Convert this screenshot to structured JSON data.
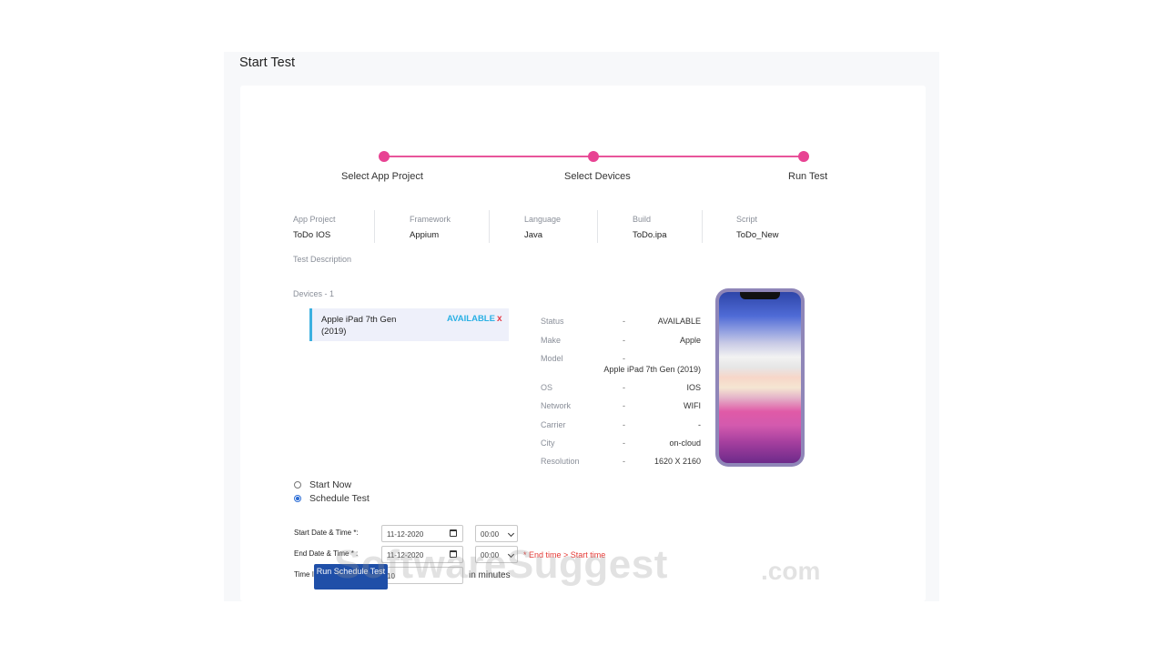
{
  "page": {
    "title": "Start Test"
  },
  "stepper": {
    "steps": [
      {
        "label": "Select App Project"
      },
      {
        "label": "Select Devices"
      },
      {
        "label": "Run Test"
      }
    ],
    "accent": "#e84393"
  },
  "meta": {
    "app_project": {
      "label": "App Project",
      "value": "ToDo IOS"
    },
    "framework": {
      "label": "Framework",
      "value": "Appium"
    },
    "language": {
      "label": "Language",
      "value": "Java"
    },
    "build": {
      "label": "Build",
      "value": "ToDo.ipa"
    },
    "script": {
      "label": "Script",
      "value": "ToDo_New"
    },
    "test_description": {
      "label": "Test Description"
    }
  },
  "devices": {
    "heading": "Devices - 1",
    "selected": {
      "name": "Apple iPad 7th Gen (2019)",
      "status": "AVAILABLE",
      "remove": "x"
    },
    "dash": "-",
    "specs": {
      "status": {
        "label": "Status",
        "value": "AVAILABLE"
      },
      "make": {
        "label": "Make",
        "value": "Apple"
      },
      "model": {
        "label": "Model",
        "value": "Apple iPad 7th Gen (2019)"
      },
      "os": {
        "label": "OS",
        "value": "IOS"
      },
      "network": {
        "label": "Network",
        "value": "WIFI"
      },
      "carrier": {
        "label": "Carrier",
        "value": "-"
      },
      "city": {
        "label": "City",
        "value": "on-cloud"
      },
      "resolution": {
        "label": "Resolution",
        "value": "1620 X 2160"
      }
    }
  },
  "run_mode": {
    "start_now": "Start Now",
    "schedule_test": "Schedule Test",
    "selected": "schedule_test"
  },
  "schedule": {
    "start_label": "Start Date & Time *:",
    "start_date": "11-12-2020",
    "start_time": "00:00",
    "end_label": "End Date & Time * :",
    "end_date": "11-12-2020",
    "end_time": "00:00",
    "error": "* End time > Start time",
    "interval_label": "Time Interval *:",
    "interval_value": "10",
    "interval_unit": "in minutes",
    "run_button": "Run Schedule Test"
  },
  "watermark": {
    "text": "SoftwareSuggest",
    "suffix": ".com"
  }
}
